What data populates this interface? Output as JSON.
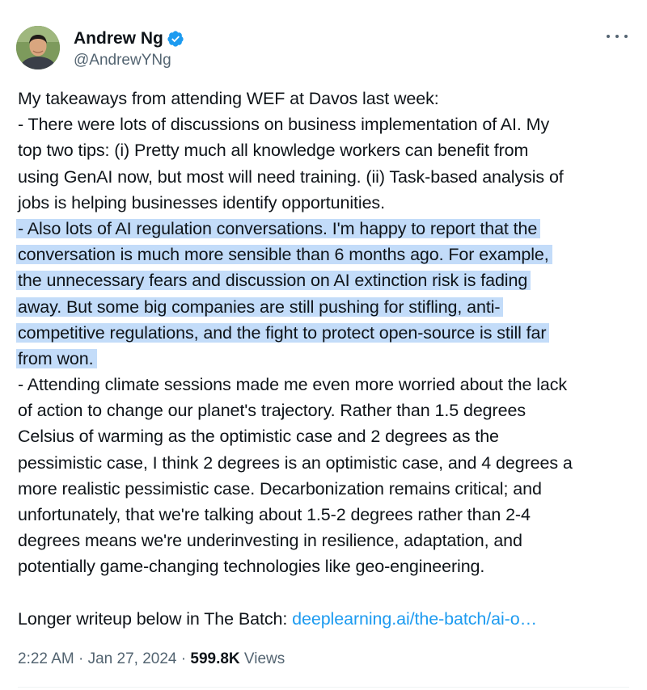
{
  "author": {
    "display_name": "Andrew Ng",
    "handle": "@AndrewYNg",
    "verified": true,
    "avatar_icon": "avatar-photo",
    "verified_icon": "verified-badge-icon",
    "more_icon": "more-options-icon"
  },
  "tweet": {
    "paragraph_1": [
      "My takeaways from attending WEF at Davos last week:",
      "- There were lots of discussions on business implementation of AI. My",
      "top two tips: (i) Pretty much all knowledge workers can benefit from",
      "using GenAI now, but most will need training. (ii) Task-based analysis of",
      "jobs is helping businesses identify opportunities."
    ],
    "highlighted": [
      "- Also lots of AI regulation conversations. I'm happy to report that the",
      "conversation is much more sensible than 6 months ago. For example,",
      "the unnecessary fears and discussion on AI extinction risk is fading",
      "away. But some big companies are still pushing for stifling, anti-",
      "competitive regulations, and the fight to protect open-source is still far",
      "from won."
    ],
    "paragraph_2": [
      "- Attending climate sessions made me even more worried about the lack",
      "of action to change our planet's trajectory. Rather than 1.5 degrees",
      "Celsius of warming as the optimistic case and 2 degrees as the",
      "pessimistic case, I think 2 degrees is an optimistic case, and 4 degrees a",
      "more realistic pessimistic case. Decarbonization remains critical; and",
      "unfortunately, that we're talking about 1.5-2 degrees rather than 2-4",
      "degrees means we're underinvesting in resilience, adaptation, and",
      "potentially game-changing technologies like geo-engineering."
    ],
    "closing_text": "Longer writeup below in The Batch: ",
    "link_text": "deeplearning.ai/the-batch/ai-o…"
  },
  "meta": {
    "time": "2:22 AM",
    "separator": " · ",
    "date": "Jan 27, 2024",
    "views_count": "599.8K",
    "views_label": " Views"
  },
  "colors": {
    "text": "#0f1419",
    "secondary": "#536471",
    "link": "#1d9bf0",
    "highlight": "#c3dcf9",
    "verified": "#1d9bf0"
  }
}
